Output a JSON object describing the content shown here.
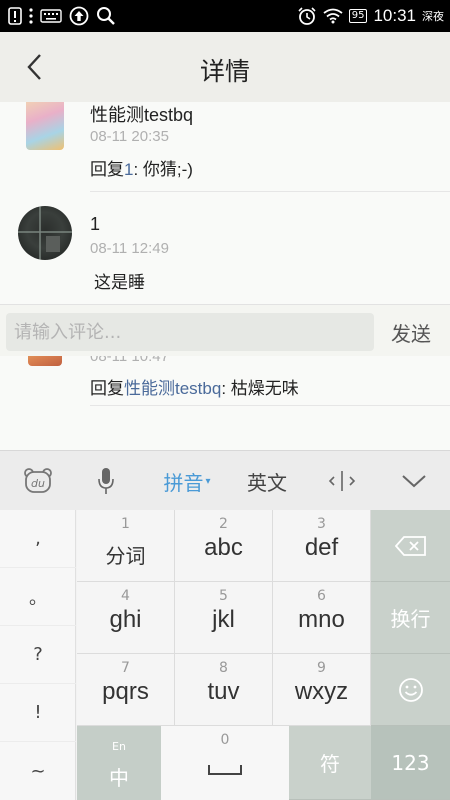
{
  "status_bar": {
    "time": "10:31",
    "battery": "95",
    "mode": "深夜",
    "icons": [
      "alert-icon",
      "keyboard-icon",
      "upload-icon",
      "search-icon",
      "alarm-icon",
      "wifi-icon",
      "battery-icon"
    ]
  },
  "header": {
    "title": "详情",
    "back_icon": "chevron-left-icon"
  },
  "comments": [
    {
      "name": "性能测testbq",
      "time": "08-11 20:35",
      "reply_prefix": "回复",
      "reply_to": "1",
      "reply_sep": ": ",
      "text": "你猜;-)"
    },
    {
      "name": "1",
      "time": "08-11 12:49",
      "reply_prefix": "",
      "reply_to": "",
      "reply_sep": "",
      "text": "这是睡"
    },
    {
      "name": "",
      "time": "08-11 10:47",
      "reply_prefix": "回复",
      "reply_to": "性能测testbq",
      "reply_sep": ": ",
      "text": "枯燥无味"
    }
  ],
  "input_bar": {
    "placeholder": "请输入评论...",
    "send_label": "发送"
  },
  "keyboard": {
    "toolbar": {
      "logo_icon": "du-bear-icon",
      "mic_icon": "microphone-icon",
      "pinyin": "拼音",
      "english": "英文",
      "cursor_icon": "cursor-move-icon",
      "collapse_icon": "chevron-down-icon"
    },
    "punctuation": [
      ",",
      "。",
      "?",
      "!",
      "~"
    ],
    "keys": [
      {
        "num": "1",
        "label": "分词"
      },
      {
        "num": "2",
        "label": "abc"
      },
      {
        "num": "3",
        "label": "def"
      },
      {
        "num": "4",
        "label": "ghi"
      },
      {
        "num": "5",
        "label": "jkl"
      },
      {
        "num": "6",
        "label": "mno"
      },
      {
        "num": "7",
        "label": "pqrs"
      },
      {
        "num": "8",
        "label": "tuv"
      },
      {
        "num": "9",
        "label": "wxyz"
      }
    ],
    "backspace_icon": "backspace-icon",
    "enter_label": "换行",
    "emoji_icon": "smiley-icon",
    "lang_small": "En",
    "lang_main": "中",
    "space_num": "0",
    "space_icon": "space-icon",
    "symbol_label": "符",
    "num_label": "123"
  }
}
